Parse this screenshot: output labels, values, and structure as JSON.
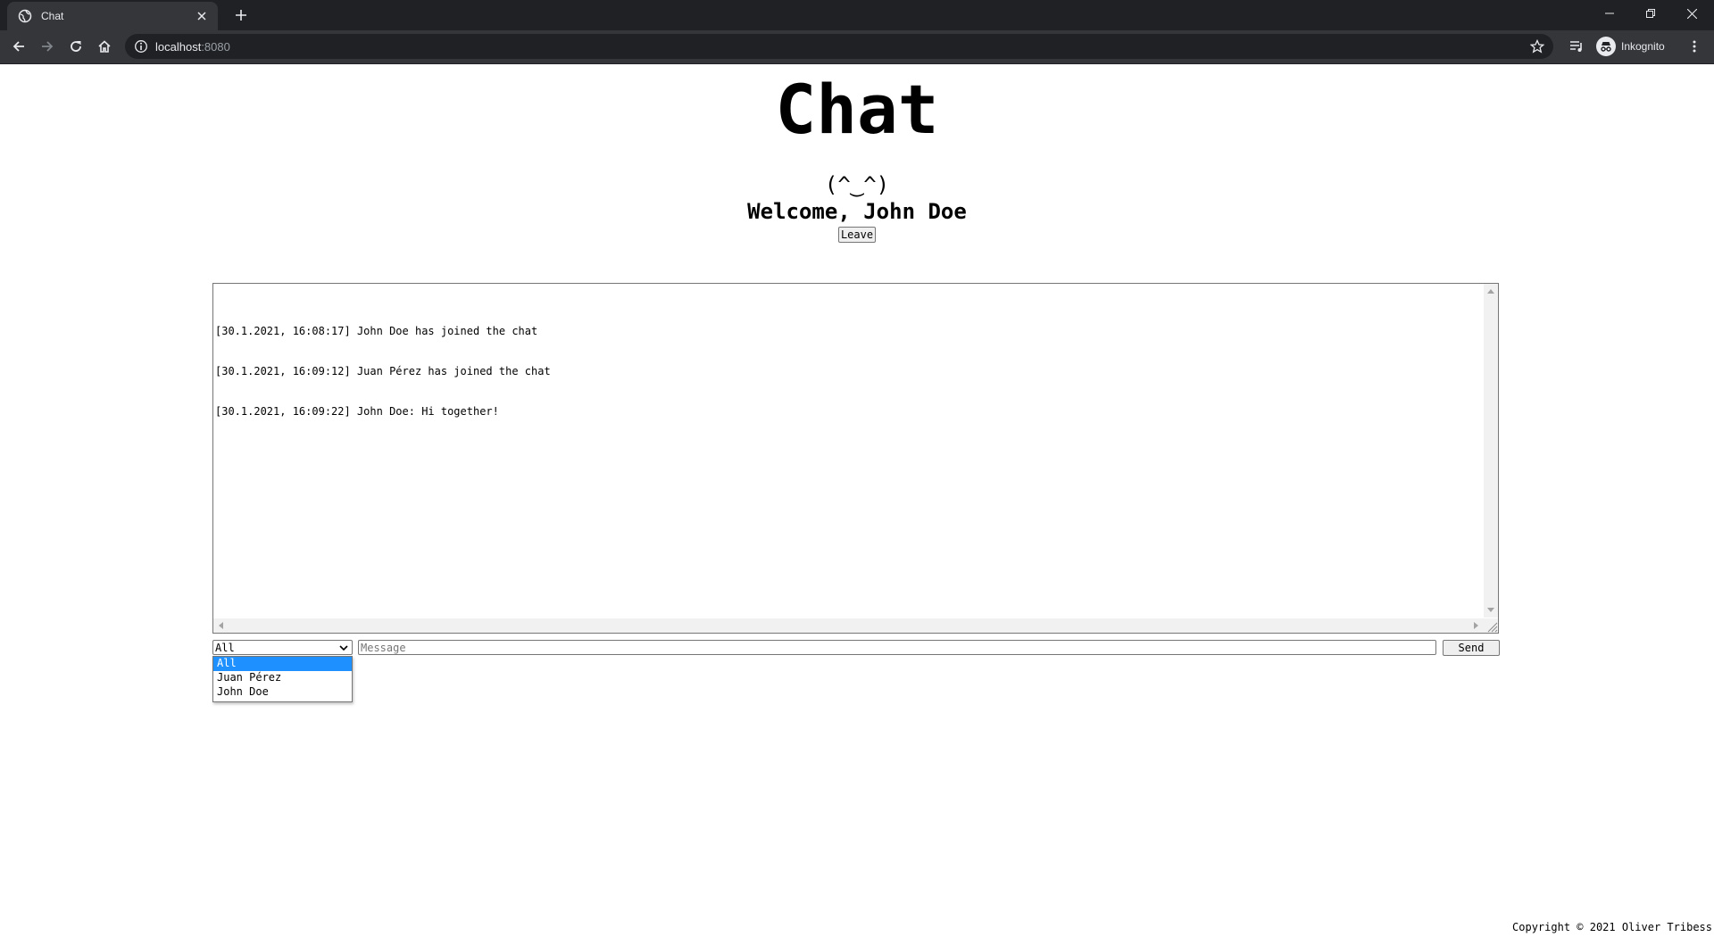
{
  "browser": {
    "tab_title": "Chat",
    "url_host": "localhost",
    "url_port": ":8080",
    "profile_label": "Inkognito",
    "theme": {
      "dark": "#202124",
      "toolbar": "#35363a",
      "text": "#e8eaed"
    }
  },
  "page": {
    "title": "Chat",
    "emoticon": "(^‿^)",
    "welcome": "Welcome, John Doe",
    "leave_label": "Leave"
  },
  "log": {
    "lines": [
      "[30.1.2021, 16:08:17] John Doe has joined the chat",
      "[30.1.2021, 16:09:12] Juan Pérez has joined the chat",
      "[30.1.2021, 16:09:22] John Doe: Hi together!"
    ]
  },
  "composer": {
    "recipient_selected": "All",
    "recipient_options": [
      "All",
      "Juan Pérez",
      "John Doe"
    ],
    "message_placeholder": "Message",
    "send_label": "Send",
    "highlight_color": "#1e90ff"
  },
  "footer": {
    "copyright": "Copyright © 2021 Oliver Tribess"
  }
}
